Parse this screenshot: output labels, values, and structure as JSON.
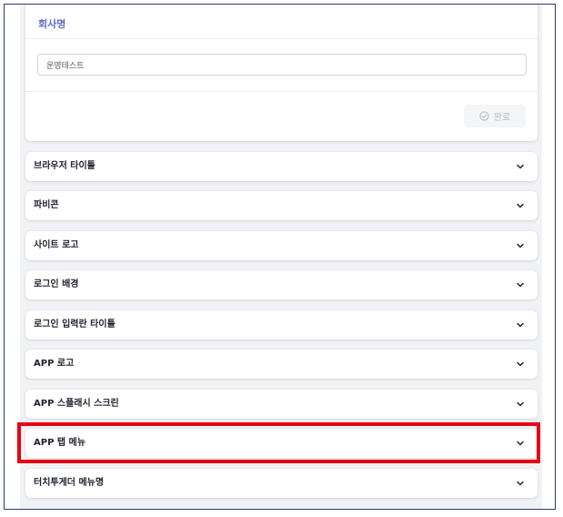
{
  "company": {
    "title": "회사명",
    "input_value": "운영테스트",
    "done_label": "완료"
  },
  "accordion": [
    {
      "label": "브라우저 타이틀",
      "icon": "chevron-down-icon"
    },
    {
      "label": "파비콘",
      "icon": "chevron-down-icon"
    },
    {
      "label": "사이트 로고",
      "icon": "chevron-down-icon"
    },
    {
      "label": "로그인 배경",
      "icon": "chevron-down-icon"
    },
    {
      "label": "로그인 입력란 타이틀",
      "icon": "chevron-down-icon"
    },
    {
      "label": "APP 로고",
      "icon": "chevron-down-icon"
    },
    {
      "label": "APP 스플래시 스크린",
      "icon": "chevron-down-icon"
    },
    {
      "label": "APP 탭 메뉴",
      "icon": "chevron-down-icon"
    },
    {
      "label": "터치투게더 메뉴명",
      "icon": "chevron-down-icon"
    }
  ],
  "colors": {
    "accent": "#5b6cc7",
    "highlight": "#e60012",
    "background": "#f1f2f5"
  }
}
